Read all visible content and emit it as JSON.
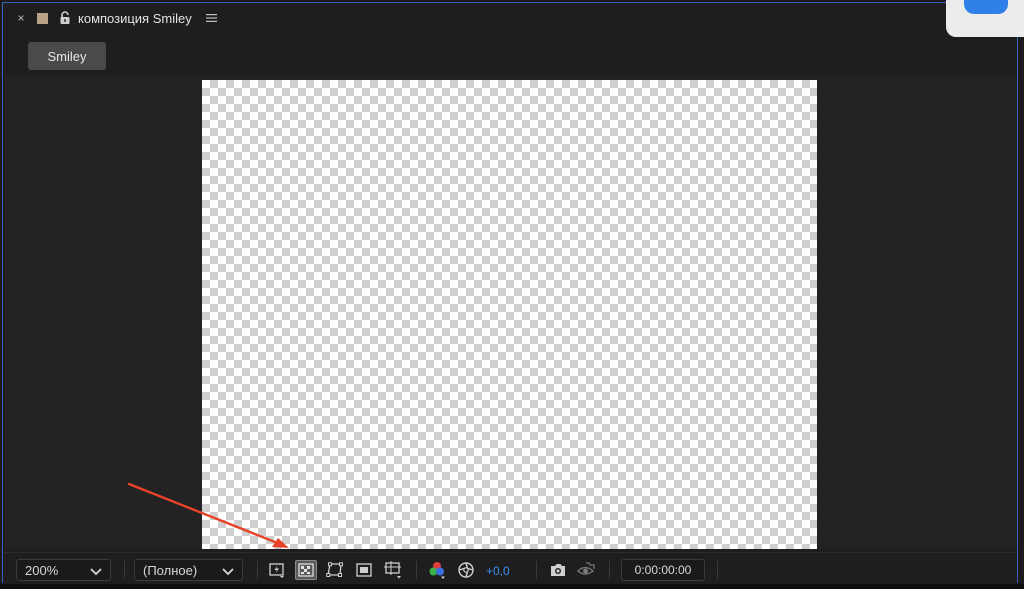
{
  "panel": {
    "close_glyph": "×",
    "title": "композиция Smiley",
    "label_color": "#b9a487",
    "border_color": "#3a5fbf",
    "icons": [
      "close-icon",
      "label-color-swatch",
      "lock-icon",
      "panel-menu-icon"
    ]
  },
  "tab": {
    "label": "Smiley"
  },
  "footer": {
    "zoom": "200%",
    "resolution": "(Полное)",
    "exposure": "+0,0",
    "timecode": "0:00:00:00",
    "exposure_color": "#3d8ef0",
    "tools": [
      "fast-previews-icon",
      "transparency-grid-icon",
      "mask-path-visibility-icon",
      "region-of-interest-icon",
      "grid-guides-icon",
      "channel-color-icon",
      "reset-exposure-icon",
      "snapshot-camera-icon",
      "show-snapshot-icon"
    ]
  },
  "annotation": {
    "arrow_color": "#e8432a"
  }
}
